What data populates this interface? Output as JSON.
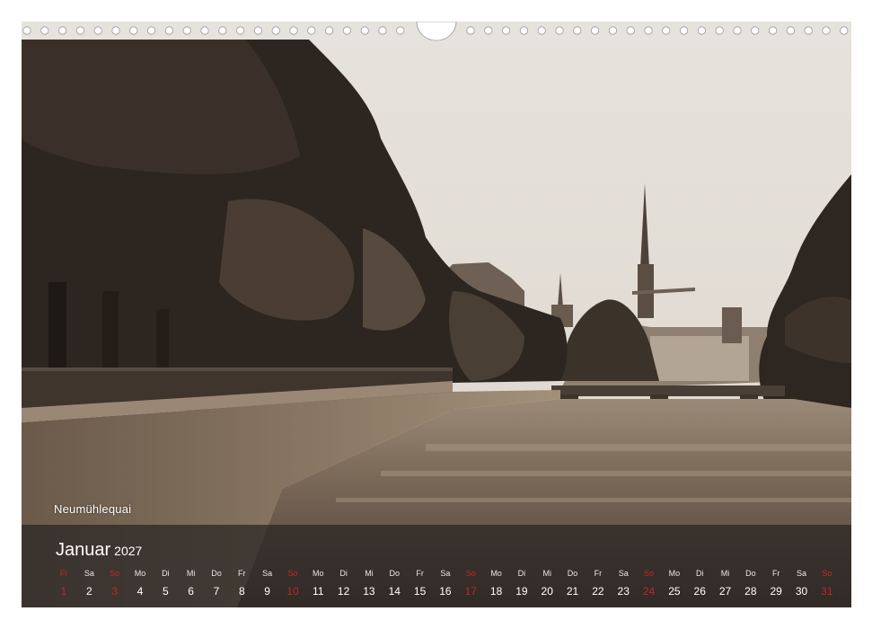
{
  "caption": "Neumühlequai",
  "calendar": {
    "month": "Januar",
    "year": "2027",
    "accent_color": "#c0282a",
    "days": [
      {
        "wd": "Fr",
        "d": "1",
        "hol": true
      },
      {
        "wd": "Sa",
        "d": "2",
        "hol": false
      },
      {
        "wd": "So",
        "d": "3",
        "hol": true
      },
      {
        "wd": "Mo",
        "d": "4",
        "hol": false
      },
      {
        "wd": "Di",
        "d": "5",
        "hol": false
      },
      {
        "wd": "Mi",
        "d": "6",
        "hol": false
      },
      {
        "wd": "Do",
        "d": "7",
        "hol": false
      },
      {
        "wd": "Fr",
        "d": "8",
        "hol": false
      },
      {
        "wd": "Sa",
        "d": "9",
        "hol": false
      },
      {
        "wd": "So",
        "d": "10",
        "hol": true
      },
      {
        "wd": "Mo",
        "d": "11",
        "hol": false
      },
      {
        "wd": "Di",
        "d": "12",
        "hol": false
      },
      {
        "wd": "Mi",
        "d": "13",
        "hol": false
      },
      {
        "wd": "Do",
        "d": "14",
        "hol": false
      },
      {
        "wd": "Fr",
        "d": "15",
        "hol": false
      },
      {
        "wd": "Sa",
        "d": "16",
        "hol": false
      },
      {
        "wd": "So",
        "d": "17",
        "hol": true
      },
      {
        "wd": "Mo",
        "d": "18",
        "hol": false
      },
      {
        "wd": "Di",
        "d": "19",
        "hol": false
      },
      {
        "wd": "Mi",
        "d": "20",
        "hol": false
      },
      {
        "wd": "Do",
        "d": "21",
        "hol": false
      },
      {
        "wd": "Fr",
        "d": "22",
        "hol": false
      },
      {
        "wd": "Sa",
        "d": "23",
        "hol": false
      },
      {
        "wd": "So",
        "d": "24",
        "hol": true
      },
      {
        "wd": "Mo",
        "d": "25",
        "hol": false
      },
      {
        "wd": "Di",
        "d": "26",
        "hol": false
      },
      {
        "wd": "Mi",
        "d": "27",
        "hol": false
      },
      {
        "wd": "Do",
        "d": "28",
        "hol": false
      },
      {
        "wd": "Fr",
        "d": "29",
        "hol": false
      },
      {
        "wd": "Sa",
        "d": "30",
        "hol": false
      },
      {
        "wd": "So",
        "d": "31",
        "hol": true
      }
    ]
  }
}
